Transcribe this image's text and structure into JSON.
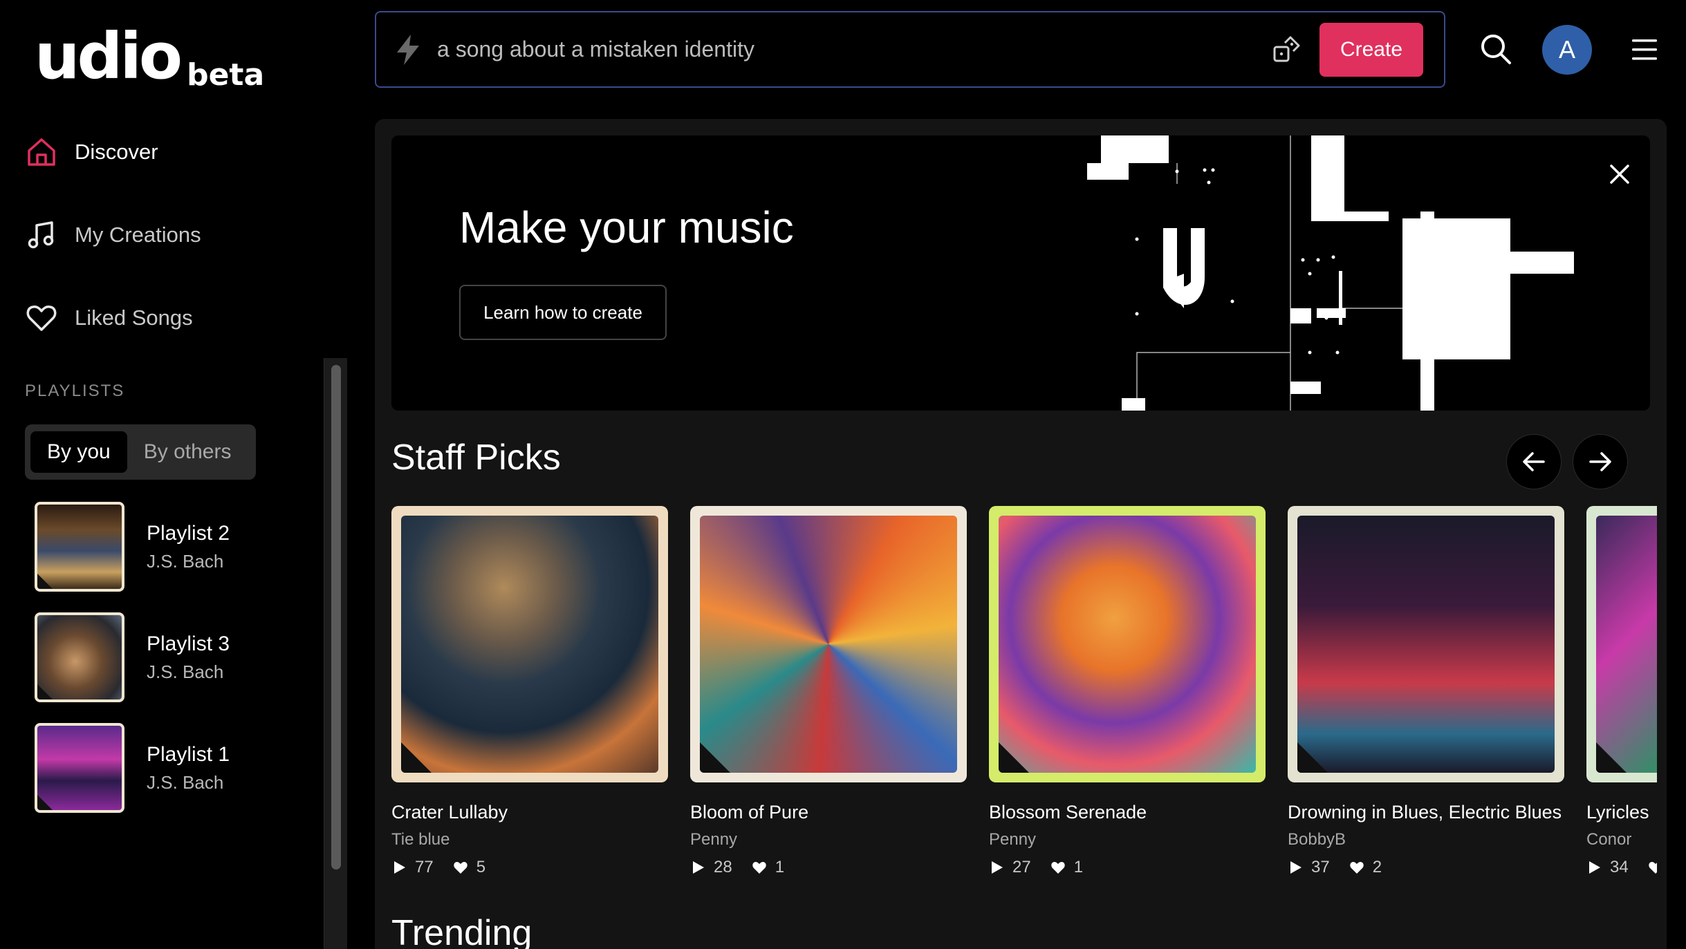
{
  "logo": {
    "word": "udio",
    "badge": "beta"
  },
  "nav": [
    {
      "label": "Discover",
      "icon": "home-icon"
    },
    {
      "label": "My Creations",
      "icon": "music-note-icon"
    },
    {
      "label": "Liked Songs",
      "icon": "heart-icon"
    }
  ],
  "playlists": {
    "heading": "PLAYLISTS",
    "filters": [
      "By you",
      "By others"
    ],
    "selected_filter": "By you",
    "items": [
      {
        "name": "Playlist 2",
        "owner": "J.S. Bach"
      },
      {
        "name": "Playlist 3",
        "owner": "J.S. Bach"
      },
      {
        "name": "Playlist 1",
        "owner": "J.S. Bach"
      }
    ]
  },
  "prompt": {
    "placeholder": "a song about a mistaken identity",
    "create_label": "Create"
  },
  "account": {
    "avatar_letter": "A",
    "avatar_color": "#2f5fa8"
  },
  "banner": {
    "title": "Make your music",
    "button_label": "Learn how to create"
  },
  "staff_picks": {
    "title": "Staff Picks",
    "cards": [
      {
        "title": "Crater Lullaby",
        "artist": "Tie blue",
        "plays": "77",
        "likes": "5"
      },
      {
        "title": "Bloom of Pure",
        "artist": "Penny",
        "plays": "28",
        "likes": "1"
      },
      {
        "title": "Blossom Serenade",
        "artist": "Penny",
        "plays": "27",
        "likes": "1"
      },
      {
        "title": "Drowning in Blues, Electric Blues",
        "artist": "BobbyB",
        "plays": "37",
        "likes": "2"
      },
      {
        "title": "Lyricles",
        "artist": "Conor",
        "plays": "34",
        "likes": ""
      }
    ]
  },
  "trending": {
    "title": "Trending"
  },
  "colors": {
    "accent": "#e0305e",
    "prompt_border": "#3a4a8e",
    "panel": "#141414"
  }
}
